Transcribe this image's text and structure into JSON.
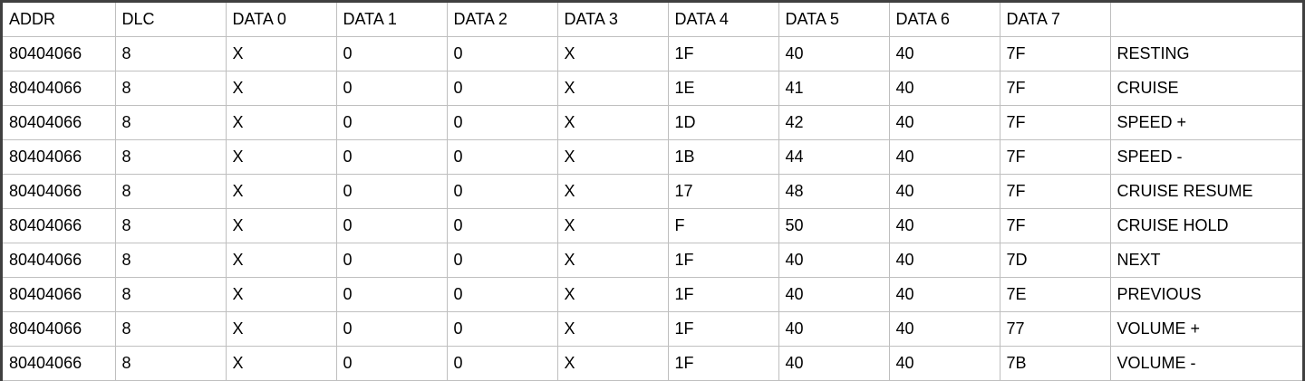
{
  "table": {
    "headers": [
      "ADDR",
      "DLC",
      "DATA 0",
      "DATA 1",
      "DATA 2",
      "DATA 3",
      "DATA 4",
      "DATA 5",
      "DATA 6",
      "DATA 7",
      ""
    ],
    "rows": [
      [
        "80404066",
        "8",
        "X",
        "0",
        "0",
        "X",
        "1F",
        "40",
        "40",
        "7F",
        "RESTING"
      ],
      [
        "80404066",
        "8",
        "X",
        "0",
        "0",
        "X",
        "1E",
        "41",
        "40",
        "7F",
        "CRUISE"
      ],
      [
        "80404066",
        "8",
        "X",
        "0",
        "0",
        "X",
        "1D",
        "42",
        "40",
        "7F",
        "SPEED +"
      ],
      [
        "80404066",
        "8",
        "X",
        "0",
        "0",
        "X",
        "1B",
        "44",
        "40",
        "7F",
        "SPEED -"
      ],
      [
        "80404066",
        "8",
        "X",
        "0",
        "0",
        "X",
        "17",
        "48",
        "40",
        "7F",
        "CRUISE RESUME"
      ],
      [
        "80404066",
        "8",
        "X",
        "0",
        "0",
        "X",
        "F",
        "50",
        "40",
        "7F",
        "CRUISE HOLD"
      ],
      [
        "80404066",
        "8",
        "X",
        "0",
        "0",
        "X",
        "1F",
        "40",
        "40",
        "7D",
        "NEXT"
      ],
      [
        "80404066",
        "8",
        "X",
        "0",
        "0",
        "X",
        "1F",
        "40",
        "40",
        "7E",
        "PREVIOUS"
      ],
      [
        "80404066",
        "8",
        "X",
        "0",
        "0",
        "X",
        "1F",
        "40",
        "40",
        "77",
        "VOLUME +"
      ],
      [
        "80404066",
        "8",
        "X",
        "0",
        "0",
        "X",
        "1F",
        "40",
        "40",
        "7B",
        "VOLUME -"
      ]
    ]
  }
}
